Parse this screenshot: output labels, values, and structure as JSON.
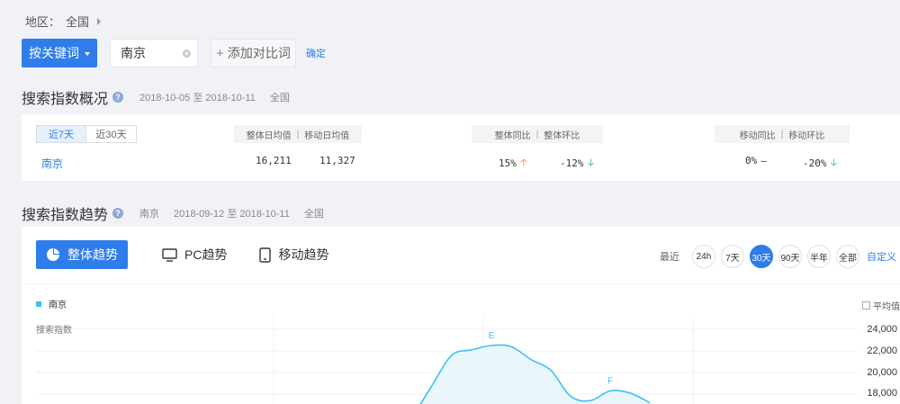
{
  "breadcrumb": {
    "label": "地区：",
    "value": "全国"
  },
  "search": {
    "keyword_button": "按关键词",
    "keyword": "南京",
    "add_compare": "添加对比词",
    "confirm": "确定"
  },
  "overview": {
    "title": "搜索指数概况",
    "date_range": "2018-10-05 至 2018-10-11",
    "region": "全国",
    "tabs": [
      "近7天",
      "近30天"
    ],
    "headers": {
      "avg": [
        "整体日均值",
        "移动日均值"
      ],
      "yoy": [
        "整体同比",
        "整体环比"
      ],
      "mobile": [
        "移动同比",
        "移动环比"
      ]
    },
    "row": {
      "city": "南京",
      "overall_avg": "16,211",
      "mobile_avg": "11,327",
      "overall_yoy": "15%",
      "overall_mom": "-12%",
      "mobile_yoy": "0%",
      "mobile_mom": "-20%"
    }
  },
  "trend": {
    "title": "搜索指数趋势",
    "keyword": "南京",
    "date_range": "2018-09-12 至 2018-10-11",
    "region": "全国",
    "tabs": [
      "整体趋势",
      "PC趋势",
      "移动趋势"
    ],
    "range_label": "最近",
    "ranges": [
      "24h",
      "7天",
      "30天",
      "90天",
      "半年",
      "全部"
    ],
    "active_range": "30天",
    "custom": "自定义",
    "legend": "南京",
    "avg_toggle": "平均值",
    "y_label": "搜索指数"
  },
  "chart_data": {
    "type": "area",
    "series": [
      {
        "name": "南京",
        "color": "#3fbff0"
      }
    ],
    "y_ticks": [
      "24,000",
      "22,000",
      "20,000",
      "18,000"
    ],
    "ylim": [
      17000,
      25000
    ],
    "markers": [
      "E",
      "F"
    ],
    "points": [
      {
        "i": 19,
        "y": 15800
      },
      {
        "i": 20,
        "y": 18800
      },
      {
        "i": 21,
        "y": 21600
      },
      {
        "i": 22,
        "y": 22100
      },
      {
        "i": 23,
        "y": 22500
      },
      {
        "i": 24,
        "y": 22400
      },
      {
        "i": 25,
        "y": 21200
      },
      {
        "i": 26,
        "y": 20200
      },
      {
        "i": 27,
        "y": 17800
      },
      {
        "i": 28,
        "y": 17400
      },
      {
        "i": 29,
        "y": 18300
      },
      {
        "i": 30,
        "y": 18100
      },
      {
        "i": 31,
        "y": 17200
      }
    ],
    "marker_points": [
      {
        "label": "E",
        "i": 23
      },
      {
        "label": "F",
        "i": 29
      }
    ]
  }
}
